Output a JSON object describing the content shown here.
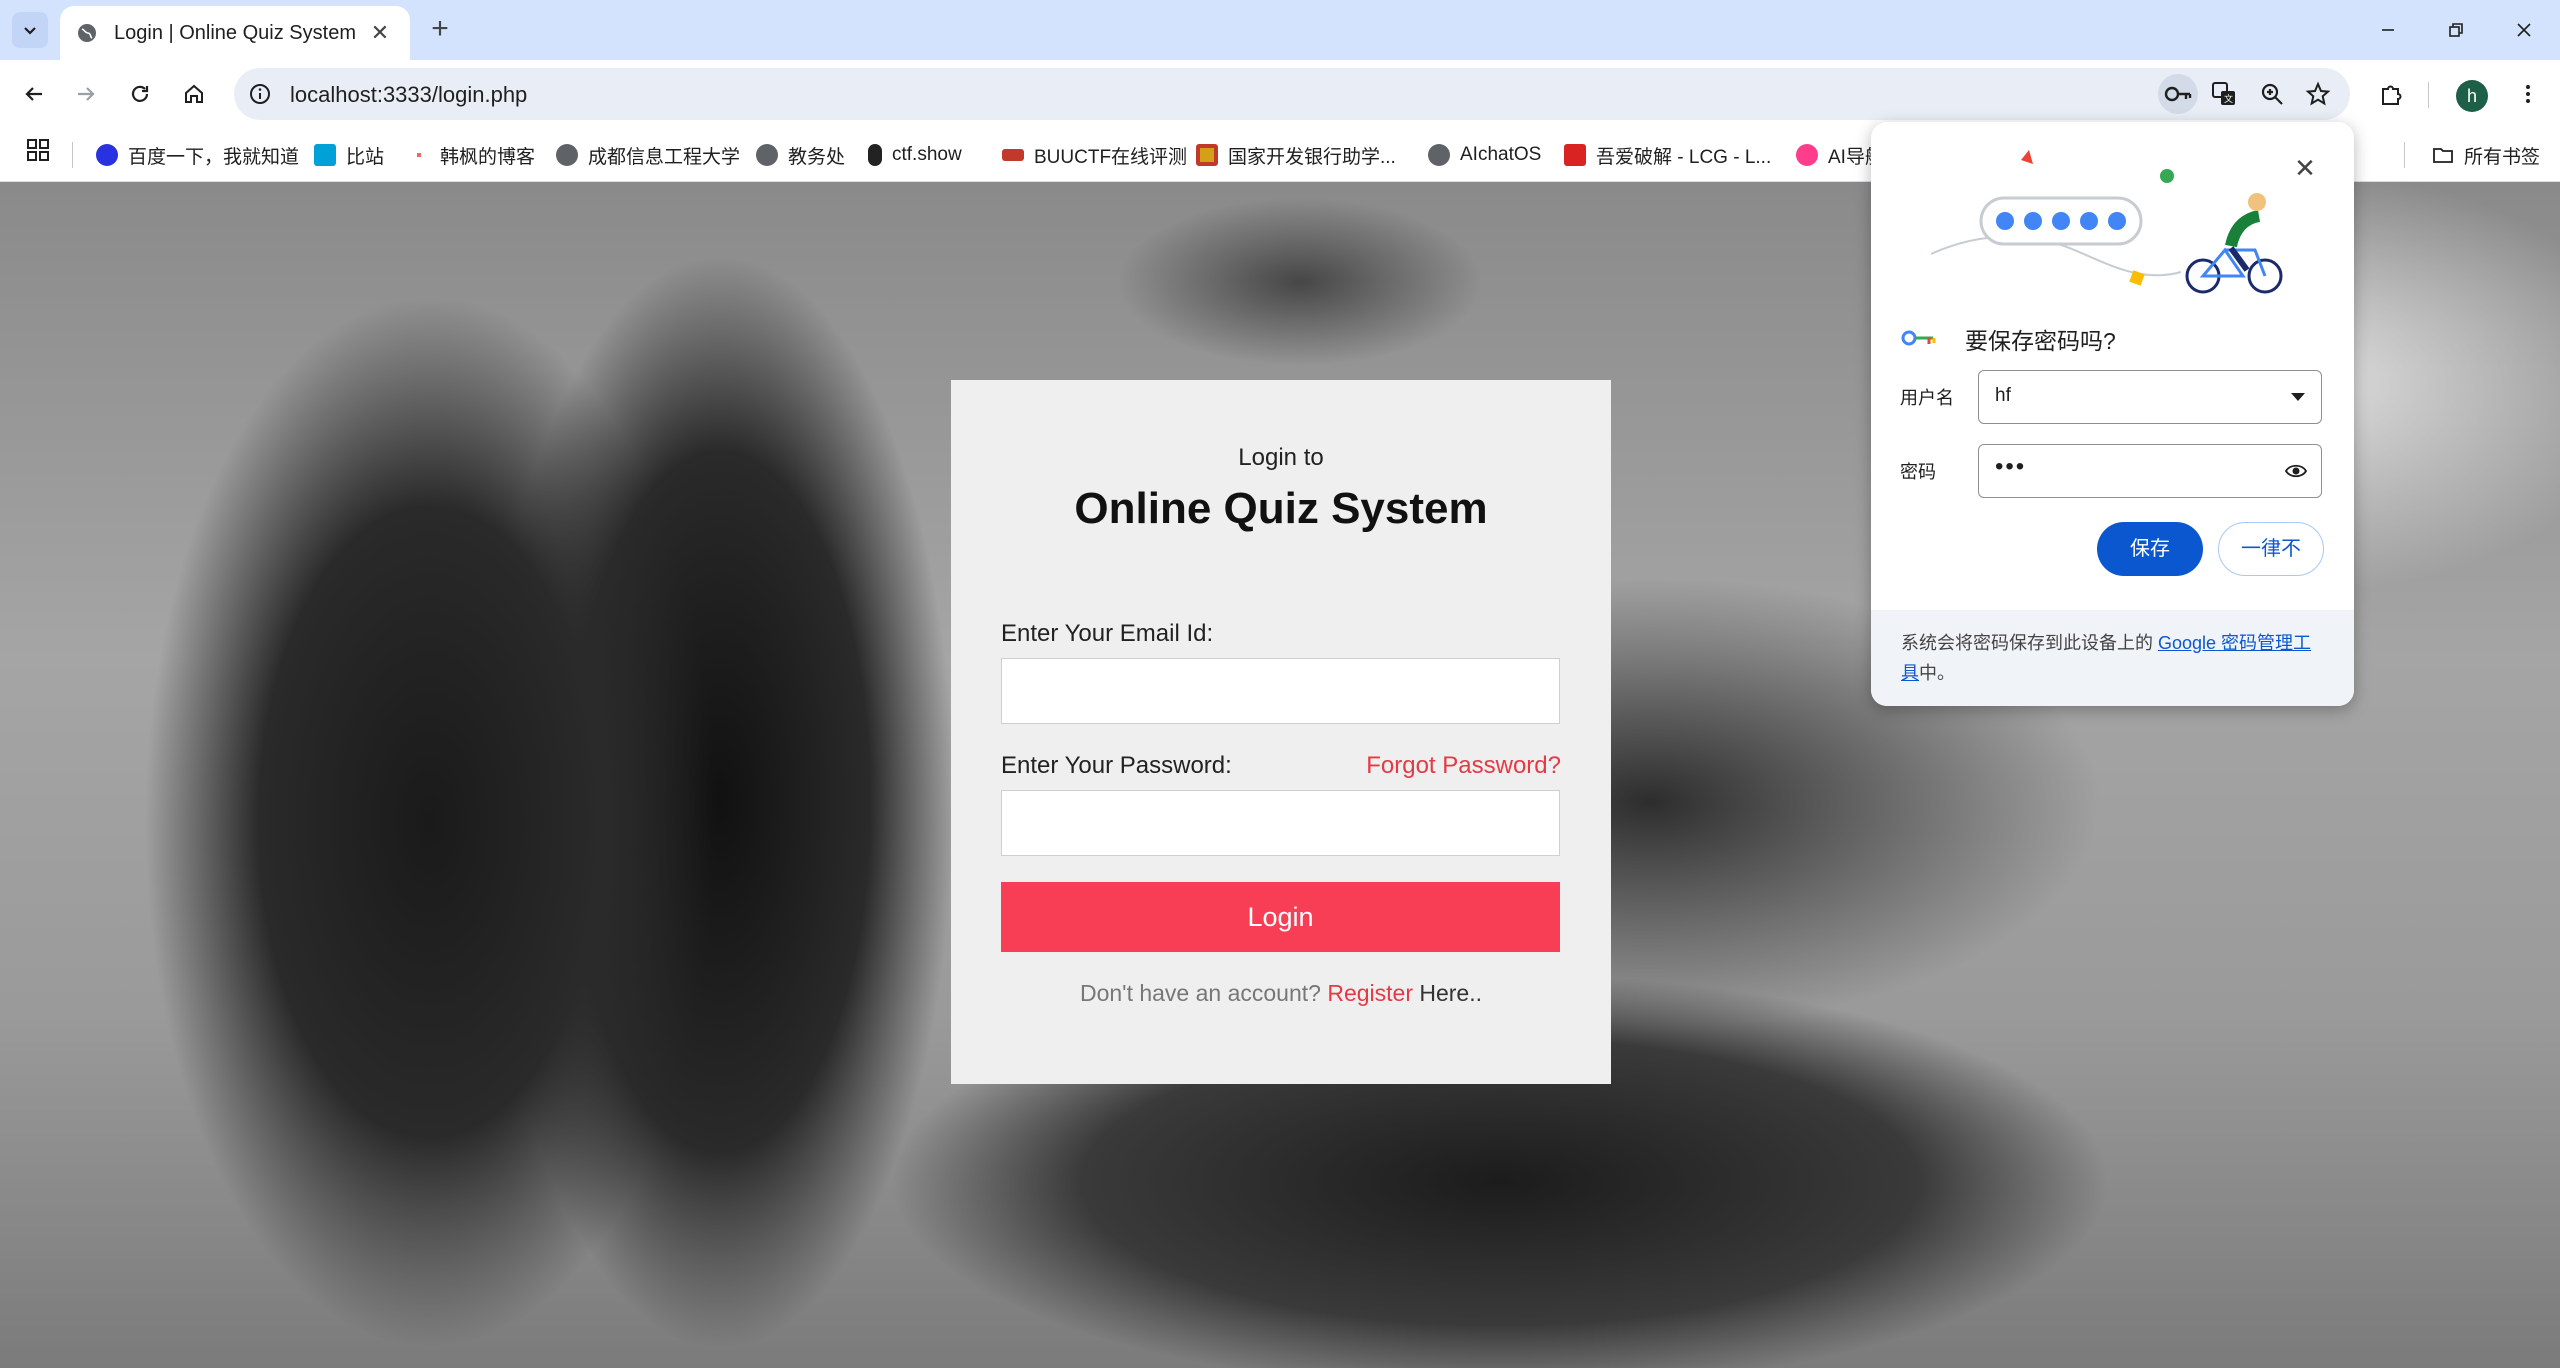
{
  "browser": {
    "tab_title": "Login | Online Quiz System",
    "url": "localhost:3333/login.php",
    "avatar_letter": "h",
    "bookmarks": [
      "百度一下，我就知道",
      "比站",
      "韩枫的博客",
      "成都信息工程大学",
      "教务处",
      "ctf.show",
      "BUUCTF在线评测",
      "国家开发银行助学...",
      "AIchatOS",
      "吾爱破解 - LCG - L...",
      "AI导航"
    ],
    "all_bookmarks": "所有书签"
  },
  "login": {
    "subtitle": "Login to",
    "title": "Online Quiz System",
    "email_label": "Enter Your Email Id:",
    "email_value": "",
    "password_label": "Enter Your Password:",
    "password_value": "",
    "forgot_password": "Forgot Password?",
    "login_button": "Login",
    "no_account": "Don't have an account? ",
    "register_link": "Register",
    "here": " Here.."
  },
  "password_prompt": {
    "title": "要保存密码吗?",
    "username_label": "用户名",
    "username_value": "hf",
    "password_label": "密码",
    "password_value": "•••",
    "save_button": "保存",
    "never_button": "一律不",
    "footer_text": "系统会将密码保存到此设备上的 ",
    "footer_link": "Google 密码管理工具",
    "footer_end": "中。"
  },
  "colors": {
    "accent": "#f73e55",
    "link": "#e63946",
    "chrome_blue": "#0b57d0",
    "tabstrip": "#d3e3fd"
  }
}
